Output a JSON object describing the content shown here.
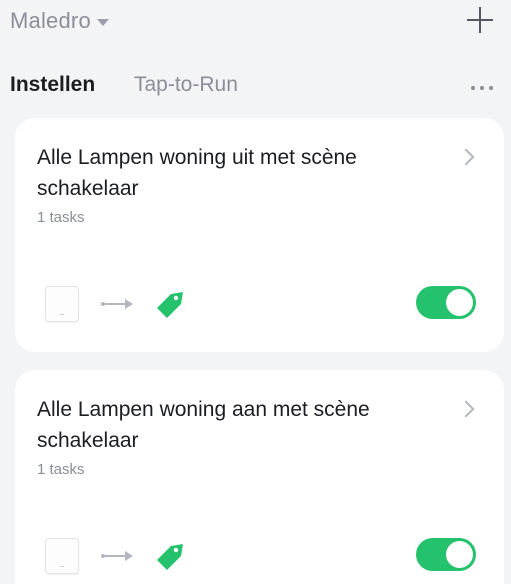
{
  "header": {
    "home_name": "Maledro",
    "add_icon": "plus-icon",
    "dropdown_icon": "caret-down-icon"
  },
  "tabs": [
    {
      "label": "Instellen",
      "active": true
    },
    {
      "label": "Tap-to-Run",
      "active": false
    }
  ],
  "more_icon": "more-dots-icon",
  "automations": [
    {
      "title": "Alle Lampen woning uit met scène schakelaar",
      "tasks": "1 tasks",
      "enabled": true,
      "condition_icon": "scene-switch-device-icon",
      "action_icon": "scene-tag-icon"
    },
    {
      "title": "Alle Lampen woning aan met scène schakelaar",
      "tasks": "1 tasks",
      "enabled": true,
      "condition_icon": "scene-switch-device-icon",
      "action_icon": "scene-tag-icon"
    }
  ],
  "colors": {
    "accent_green": "#25c26e",
    "background": "#f3f4f6",
    "card": "#ffffff",
    "text_primary": "#1b1d21",
    "text_secondary": "#8a8e96"
  }
}
